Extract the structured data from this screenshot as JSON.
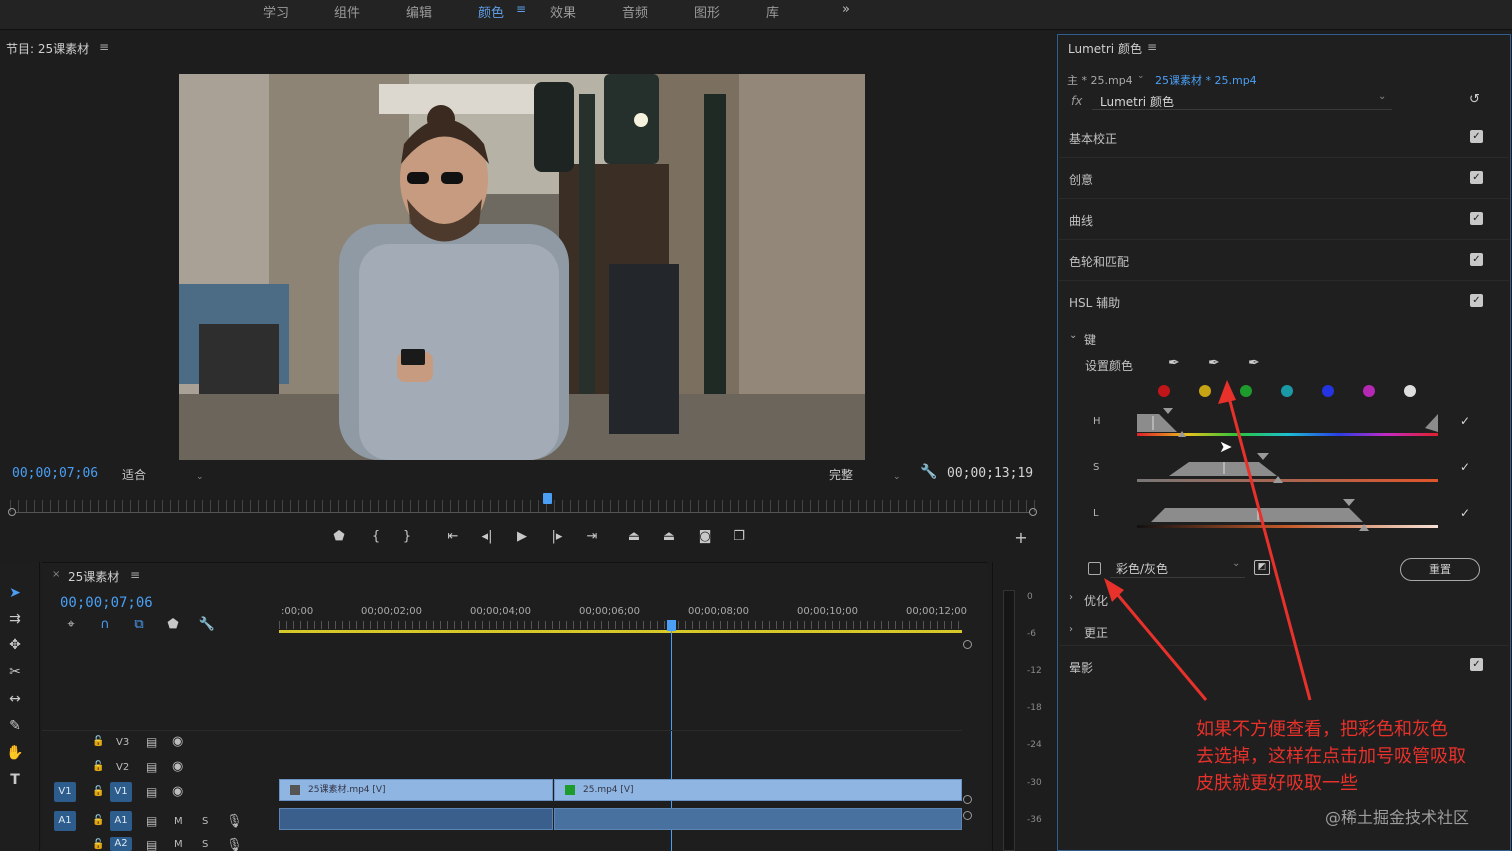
{
  "workspace_tabs": [
    {
      "label": "学习",
      "active": false
    },
    {
      "label": "组件",
      "active": false
    },
    {
      "label": "编辑",
      "active": false
    },
    {
      "label": "颜色",
      "active": true
    },
    {
      "label": "效果",
      "active": false
    },
    {
      "label": "音频",
      "active": false
    },
    {
      "label": "图形",
      "active": false
    },
    {
      "label": "库",
      "active": false
    }
  ],
  "program": {
    "title": "节目: 25课素材",
    "current_tc": "00;00;07;06",
    "fit_label": "适合",
    "quality_label": "完整",
    "duration_tc": "00;00;13;19"
  },
  "timeline": {
    "sequence_name": "25课素材",
    "current_tc": "00;00;07;06",
    "ruler": [
      ":00;00",
      "00;00;02;00",
      "00;00;04;00",
      "00;00;06;00",
      "00;00;08;00",
      "00;00;10;00",
      "00;00;12;00"
    ],
    "tracks": [
      {
        "name": "V3"
      },
      {
        "name": "V2"
      },
      {
        "name": "V1",
        "source": "V1"
      },
      {
        "name": "A1",
        "source": "A1"
      },
      {
        "name": "A2"
      }
    ],
    "clips": [
      {
        "label": "25课素材.mp4 [V]"
      },
      {
        "label": "25.mp4 [V]"
      }
    ],
    "audio_buttons": {
      "mute": "M",
      "solo": "S"
    }
  },
  "meter_ticks": [
    "0",
    "-6",
    "-12",
    "-18",
    "-24",
    "-30",
    "-36"
  ],
  "lumetri": {
    "panel_title": "Lumetri 颜色",
    "source_master": "主 * 25.mp4",
    "source_clip": "25课素材 * 25.mp4",
    "fx_label": "fx",
    "effect_name": "Lumetri 颜色",
    "sections": [
      {
        "label": "基本校正",
        "enabled": true
      },
      {
        "label": "创意",
        "enabled": true
      },
      {
        "label": "曲线",
        "enabled": true
      },
      {
        "label": "色轮和匹配",
        "enabled": true
      },
      {
        "label": "HSL 辅助",
        "enabled": true
      }
    ],
    "key_label": "键",
    "set_color_label": "设置颜色",
    "swatch_colors": [
      "#c0161a",
      "#c6a414",
      "#1e9b2d",
      "#1a9aa4",
      "#2434e0",
      "#b428b4",
      "#dedede"
    ],
    "sliders": [
      {
        "label": "H",
        "checked": true
      },
      {
        "label": "S",
        "checked": true
      },
      {
        "label": "L",
        "checked": true
      }
    ],
    "color_gray_label": "彩色/灰色",
    "reset_label": "重置",
    "refine_label": "优化",
    "correction_label": "更正",
    "vignette_label": "晕影",
    "vignette_enabled": true
  },
  "annotation": {
    "lines": [
      "如果不方便查看，把彩色和灰色",
      "去选掉，这样在点击加号吸管吸取",
      "皮肤就更好吸取一些"
    ],
    "color": "#e8312b"
  },
  "watermark": "@稀土掘金技术社区"
}
